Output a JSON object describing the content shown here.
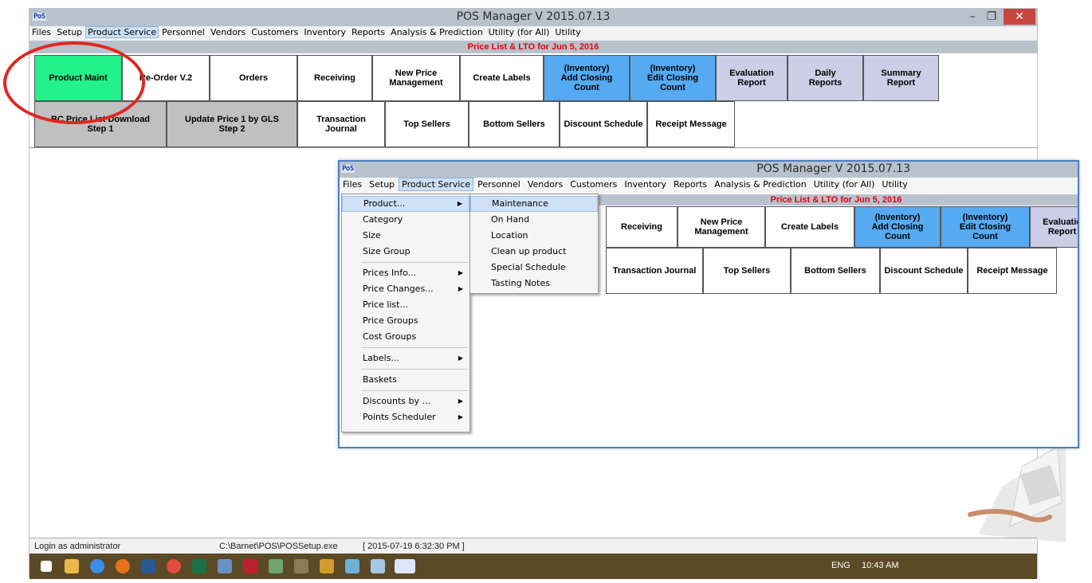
{
  "app": {
    "title": "POS Manager V 2015.07.13",
    "logo": "PoS",
    "window_buttons": [
      "–",
      "❐",
      "✕"
    ]
  },
  "menu": [
    "Files",
    "Setup",
    "Product Service",
    "Personnel",
    "Vendors",
    "Customers",
    "Inventory",
    "Reports",
    "Analysis & Prediction",
    "Utility (for All)",
    "Utility"
  ],
  "info_bar": "Price List & LTO for  Jun 5, 2016",
  "toolbar_row1": [
    {
      "label": "Product Maint"
    },
    {
      "label": "Re-Order V.2"
    },
    {
      "label": "Orders"
    },
    {
      "label": "Receiving"
    },
    {
      "label": "New Price\nManagement"
    },
    {
      "label": "Create Labels"
    },
    {
      "label": "(Inventory)\nAdd Closing\nCount"
    },
    {
      "label": "(Inventory)\nEdit Closing\nCount"
    },
    {
      "label": "Evaluation\nReport"
    },
    {
      "label": "Daily\nReports"
    },
    {
      "label": "Summary\nReport"
    }
  ],
  "toolbar_row2": [
    {
      "label": "BC Price List Download\nStep 1"
    },
    {
      "label": "Update Price 1 by GLS\nStep 2"
    },
    {
      "label": "Transaction Journal"
    },
    {
      "label": "Top Sellers"
    },
    {
      "label": "Bottom Sellers"
    },
    {
      "label": "Discount Schedule"
    },
    {
      "label": "Receipt Message"
    }
  ],
  "zoom_toolbar_row1": [
    "Receiving",
    "New Price\nManagement",
    "Create Labels",
    "(Inventory)\nAdd Closing\nCount",
    "(Inventory)\nEdit Closing\nCount",
    "Evaluatio\nReport"
  ],
  "zoom_toolbar_row2": [
    "Transaction Journal",
    "Top Sellers",
    "Bottom Sellers",
    "Discount Schedule",
    "Receipt Message"
  ],
  "product_service_menu": [
    {
      "label": "Product...",
      "submenu": true
    },
    {
      "label": "Category"
    },
    {
      "label": "Size"
    },
    {
      "label": "Size Group"
    },
    {
      "sep": true
    },
    {
      "label": "Prices Info...",
      "submenu": true
    },
    {
      "label": "Price Changes...",
      "submenu": true
    },
    {
      "label": "Price list..."
    },
    {
      "label": "Price Groups"
    },
    {
      "label": "Cost Groups"
    },
    {
      "sep": true
    },
    {
      "label": "Labels...",
      "submenu": true
    },
    {
      "sep": true
    },
    {
      "label": "Baskets"
    },
    {
      "sep": true
    },
    {
      "label": "Discounts by ...",
      "submenu": true
    },
    {
      "label": "Points Scheduler",
      "submenu": true
    }
  ],
  "product_submenu": [
    "Maintenance",
    "On Hand",
    "Location",
    "Clean up product",
    "Special Schedule",
    "Tasting Notes"
  ],
  "status_bar": {
    "login": "Login as administrator",
    "path": "C:\\Barnet\\POS\\POSSetup.exe",
    "timestamp": "[ 2015-07-19 6:32:30 PM ]"
  },
  "taskbar": {
    "language": "ENG",
    "clock": "10:43 AM"
  },
  "colors": {
    "green_button": "#22f18c",
    "blue_button": "#55aaf2",
    "lavender_button": "#cdcde8",
    "info_red": "#e8000e",
    "highlight_circle": "#e2261f"
  }
}
